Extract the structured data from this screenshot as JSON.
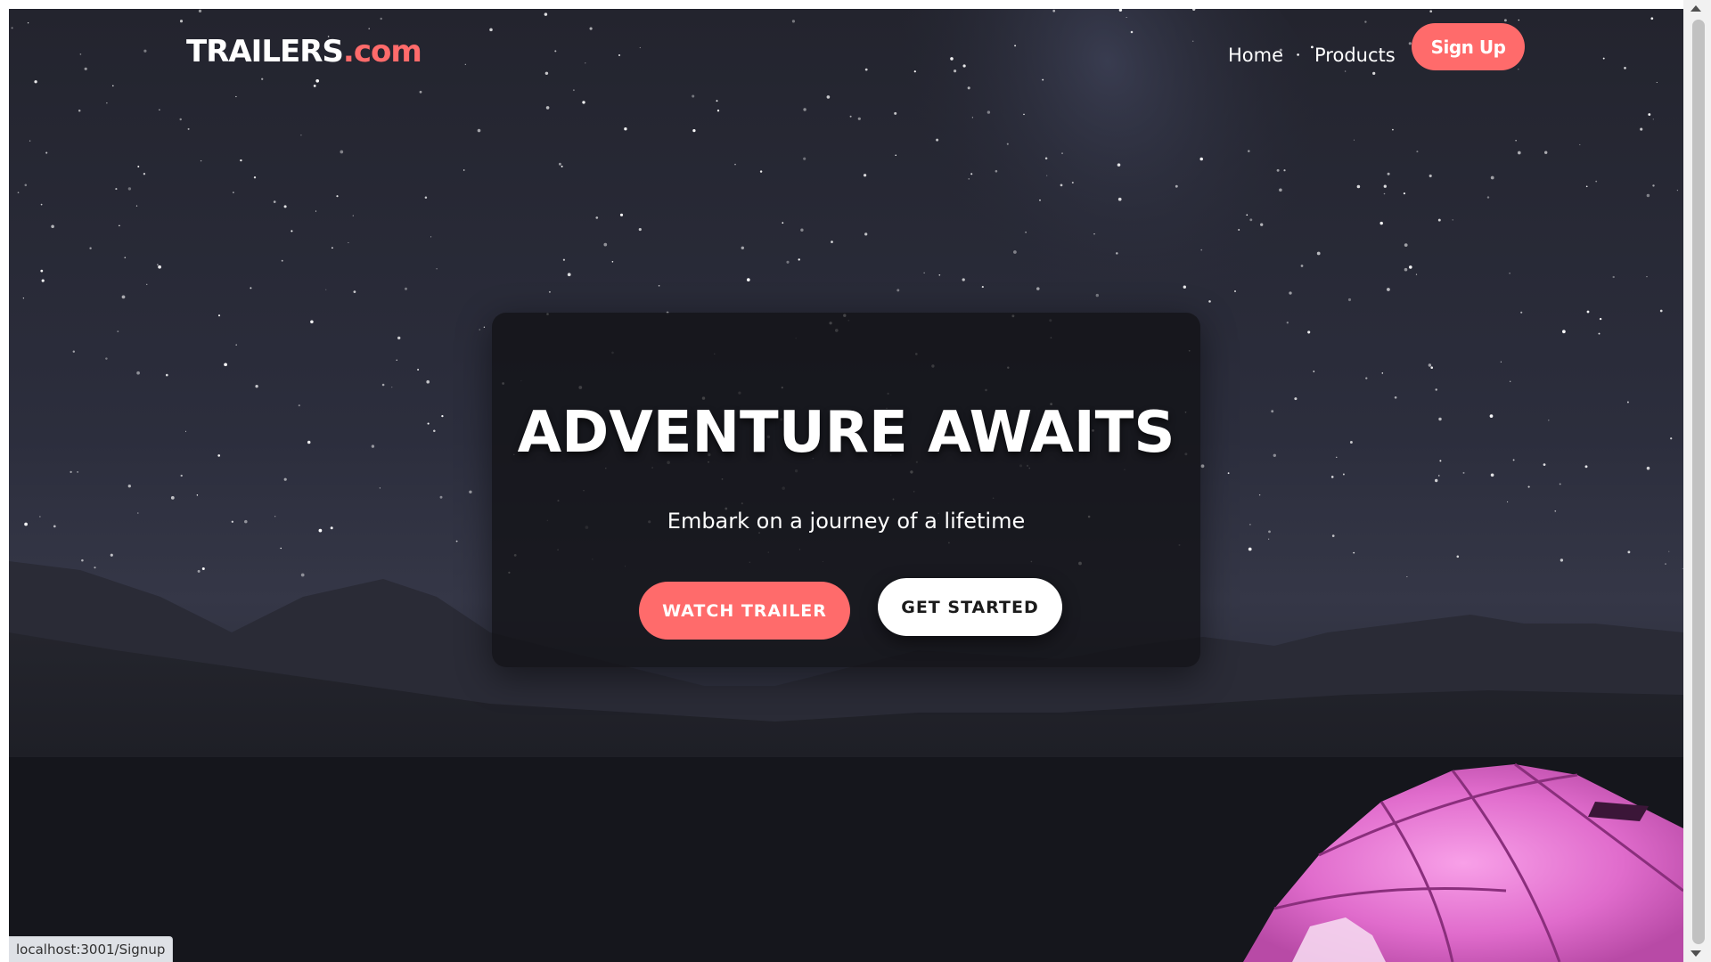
{
  "navbar": {
    "logo_main": "TRAILERS",
    "logo_accent": ".com",
    "links": [
      {
        "label": "Home"
      },
      {
        "label": "Products"
      }
    ],
    "signup_label": "Sign Up"
  },
  "hero": {
    "title": "ADVENTURE AWAITS",
    "subtitle": "Embark on a journey of a lifetime",
    "primary_button": "WATCH TRAILER",
    "secondary_button": "GET STARTED"
  },
  "status_bar": {
    "url": "localhost:3001/Signup"
  },
  "colors": {
    "accent": "#ff6b6b",
    "sky": "#2a2c3a",
    "ground": "#15161c",
    "tent": "#e86bd2",
    "white_button": "#ffffff"
  },
  "icons": [
    "scroll-up-arrow-icon",
    "scroll-down-arrow-icon"
  ]
}
